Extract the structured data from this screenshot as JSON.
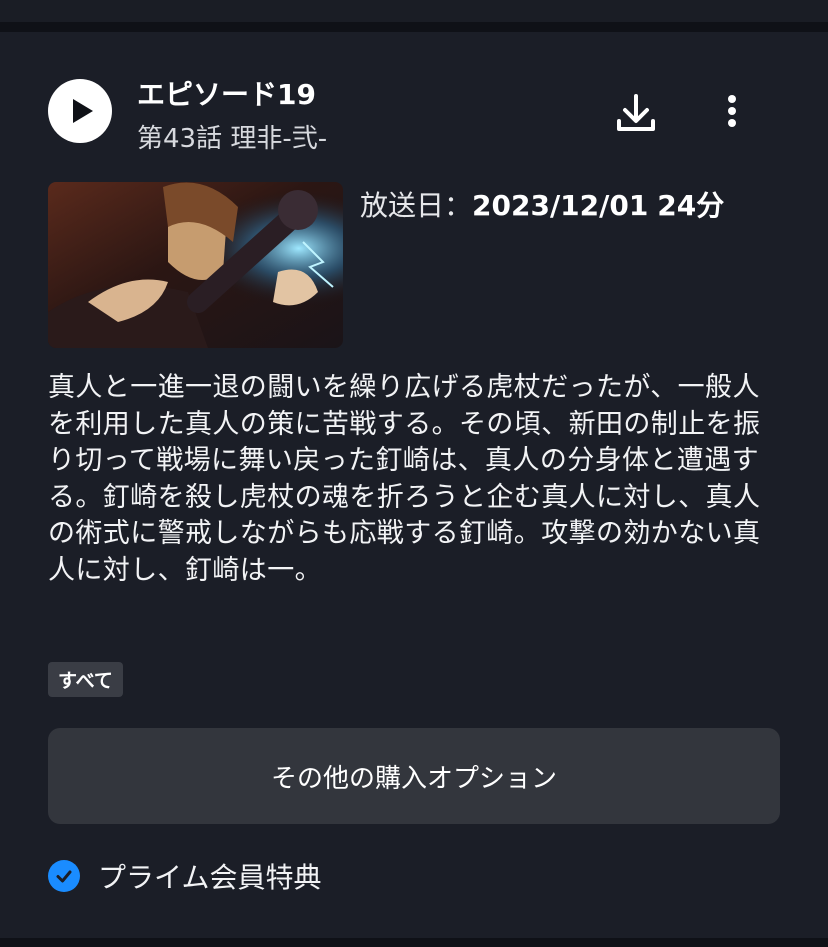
{
  "episode": {
    "title": "エピソード19",
    "subtitle": "第43話 理非-弐-",
    "air_label": "放送日：",
    "air_date": "2023/12/01",
    "duration": "24分",
    "synopsis": "真人と一進一退の闘いを繰り広げる虎杖だったが、一般人を利用した真人の策に苦戦する。その頃、新田の制止を振り切って戦場に舞い戻った釘崎は、真人の分身体と遭遇する。釘崎を殺し虎杖の魂を折ろうと企む真人に対し、真人の術式に警戒しながらも応戦する釘崎。攻撃の効かない真人に対し、釘崎は一。",
    "tag": "すべて"
  },
  "actions": {
    "purchase_label": "その他の購入オプション",
    "prime_label": "プライム会員特典"
  },
  "icons": {
    "play": "play-icon",
    "download": "download-icon",
    "more": "more-vertical-icon",
    "check": "check-circle-icon"
  },
  "colors": {
    "background": "#1b1e27",
    "accent": "#1a8cff",
    "button": "#33363d"
  }
}
